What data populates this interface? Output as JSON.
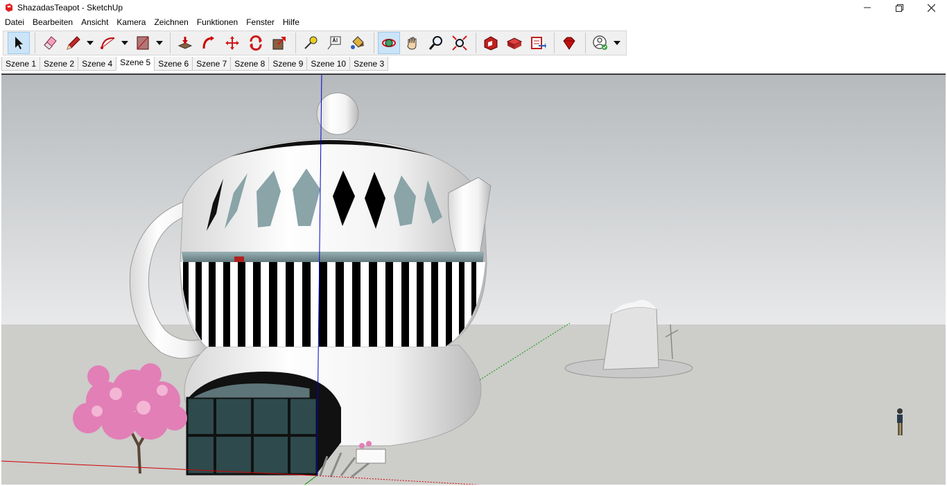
{
  "window": {
    "title": "ShazadasTeapot - SketchUp",
    "app_icon": "sketchup-logo-icon"
  },
  "window_controls": [
    "minimize-icon",
    "restore-icon",
    "close-icon"
  ],
  "menu": [
    "Datei",
    "Bearbeiten",
    "Ansicht",
    "Kamera",
    "Zeichnen",
    "Funktionen",
    "Fenster",
    "Hilfe"
  ],
  "toolbar": {
    "tools": [
      "select-icon",
      "eraser-icon",
      "pencil-icon",
      "arc-icon",
      "rectangle-icon",
      "push-pull-icon",
      "follow-me-icon",
      "move-icon",
      "rotate-icon",
      "scale-icon",
      "tape-measure-icon",
      "text-icon",
      "paint-bucket-icon",
      "orbit-icon",
      "pan-icon",
      "zoom-icon",
      "zoom-extents-icon",
      "warehouse-icon",
      "extension-warehouse-icon",
      "send-to-layout-icon",
      "ruby-icon",
      "account-icon"
    ],
    "active_tool": "orbit-icon"
  },
  "scenes": {
    "tabs": [
      "Szene 1",
      "Szene 2",
      "Szene 4",
      "Szene 5",
      "Szene 6",
      "Szene 7",
      "Szene 8",
      "Szene 9",
      "Szene 10",
      "Szene 3"
    ],
    "active": "Szene 5"
  },
  "colors": {
    "sky": "#b9bdc0",
    "ground": "#cdcdca",
    "axis_red": "#d00000",
    "axis_blue": "#0000cc",
    "axis_green": "#009900",
    "blossom": "#e27fb6"
  }
}
